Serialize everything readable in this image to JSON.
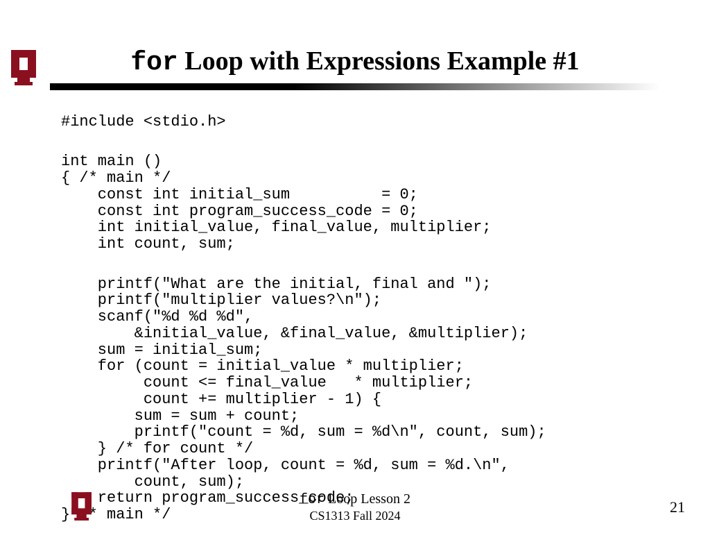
{
  "title": {
    "keyword": "for",
    "rest": " Loop with Expressions Example #1"
  },
  "code": {
    "l1": "#include <stdio.h>",
    "l2": "int main ()",
    "l3": "{ /* main */",
    "l4": "    const int initial_sum          = 0;",
    "l5": "    const int program_success_code = 0;",
    "l6": "    int initial_value, final_value, multiplier;",
    "l7": "    int count, sum;",
    "l8": "    printf(\"What are the initial, final and \");",
    "l9": "    printf(\"multiplier values?\\n\");",
    "l10": "    scanf(\"%d %d %d\",",
    "l11": "        &initial_value, &final_value, &multiplier);",
    "l12": "    sum = initial_sum;",
    "l13": "    for (count = initial_value * multiplier;",
    "l14": "         count <= final_value   * multiplier;",
    "l15": "         count += multiplier - 1) {",
    "l16": "        sum = sum + count;",
    "l17": "        printf(\"count = %d, sum = %d\\n\", count, sum);",
    "l18": "    } /* for count */",
    "l19": "    printf(\"After loop, count = %d, sum = %d.\\n\",",
    "l20": "        count, sum);",
    "l21": "    return program_success_code;",
    "l22": "} /* main */"
  },
  "footer": {
    "keyword": "for",
    "rest": " Loop Lesson 2",
    "sub": "CS1313 Fall 2024"
  },
  "page": "21",
  "logo": {
    "name": "ou-logo-icon",
    "color": "#8C1515"
  }
}
